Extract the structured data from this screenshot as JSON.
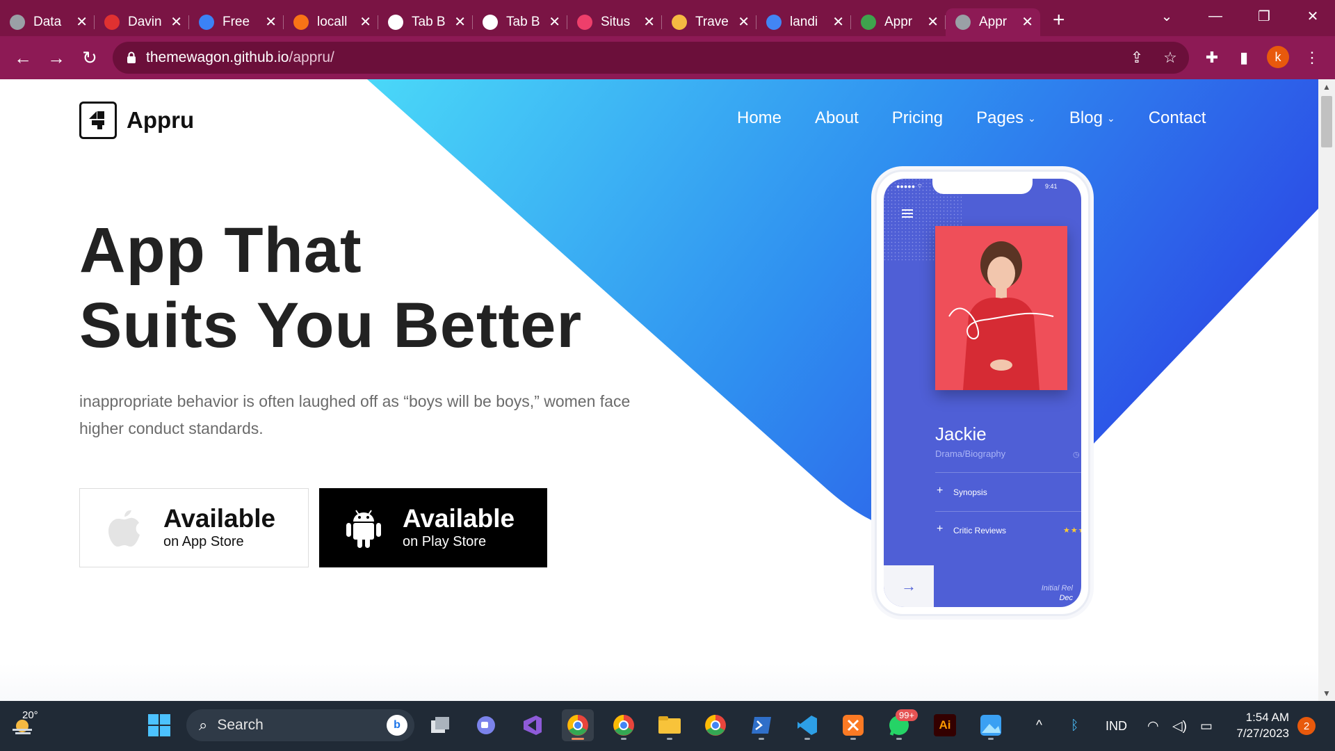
{
  "browser": {
    "tabs": [
      {
        "label": "Data",
        "icon": "globe-icon",
        "color": "#9aa0a6"
      },
      {
        "label": "Davin",
        "icon": "davinci-icon",
        "color": "#e03131"
      },
      {
        "label": "Free",
        "icon": "robot-icon",
        "color": "#3b82f6"
      },
      {
        "label": "locall",
        "icon": "xampp-icon",
        "color": "#f97316"
      },
      {
        "label": "Tab B",
        "icon": "chrome-icon",
        "color": "#ffffff"
      },
      {
        "label": "Tab B",
        "icon": "chrome-icon",
        "color": "#ffffff"
      },
      {
        "label": "Situs",
        "icon": "bitly-icon",
        "color": "#ee3f6b"
      },
      {
        "label": "Trave",
        "icon": "travel-icon",
        "color": "#f5b942"
      },
      {
        "label": "landi",
        "icon": "google-icon",
        "color": "#4285f4"
      },
      {
        "label": "Appr",
        "icon": "horse-icon",
        "color": "#3fa34d"
      },
      {
        "label": "Appr",
        "icon": "globe-icon",
        "color": "#9aa0a6"
      }
    ],
    "url_host": "themewagon.github.io",
    "url_path": "/appru/",
    "profile_initial": "k"
  },
  "site": {
    "logo_text": "Appru",
    "nav": [
      {
        "label": "Home",
        "caret": false
      },
      {
        "label": "About",
        "caret": false
      },
      {
        "label": "Pricing",
        "caret": false
      },
      {
        "label": "Pages",
        "caret": true
      },
      {
        "label": "Blog",
        "caret": true
      },
      {
        "label": "Contact",
        "caret": false
      }
    ],
    "headline_line1": "App That",
    "headline_line2": "Suits You Better",
    "lead": "inappropriate behavior is often laughed off as “boys will be boys,” women face higher conduct standards.",
    "app_store": {
      "big": "Available",
      "small": "on App Store"
    },
    "play_store": {
      "big": "Available",
      "small": "on Play Store"
    },
    "phone": {
      "time": "9:41",
      "title": "Jackie",
      "genre": "Drama/Biography",
      "rows": [
        "Synopsis",
        "Critic Reviews"
      ],
      "stars": "★★★",
      "release_label": "Initial Rel",
      "release_value": "Dec"
    },
    "colors": {
      "gradient_start": "#49d6f7",
      "gradient_end": "#2d4fe5",
      "phone_screen": "#4f5fd6"
    }
  },
  "taskbar": {
    "weather": "20°",
    "search_label": "Search",
    "whatsapp_badge": "99+",
    "language": "IND",
    "time": "1:54 AM",
    "date": "7/27/2023",
    "notifications": "2"
  }
}
